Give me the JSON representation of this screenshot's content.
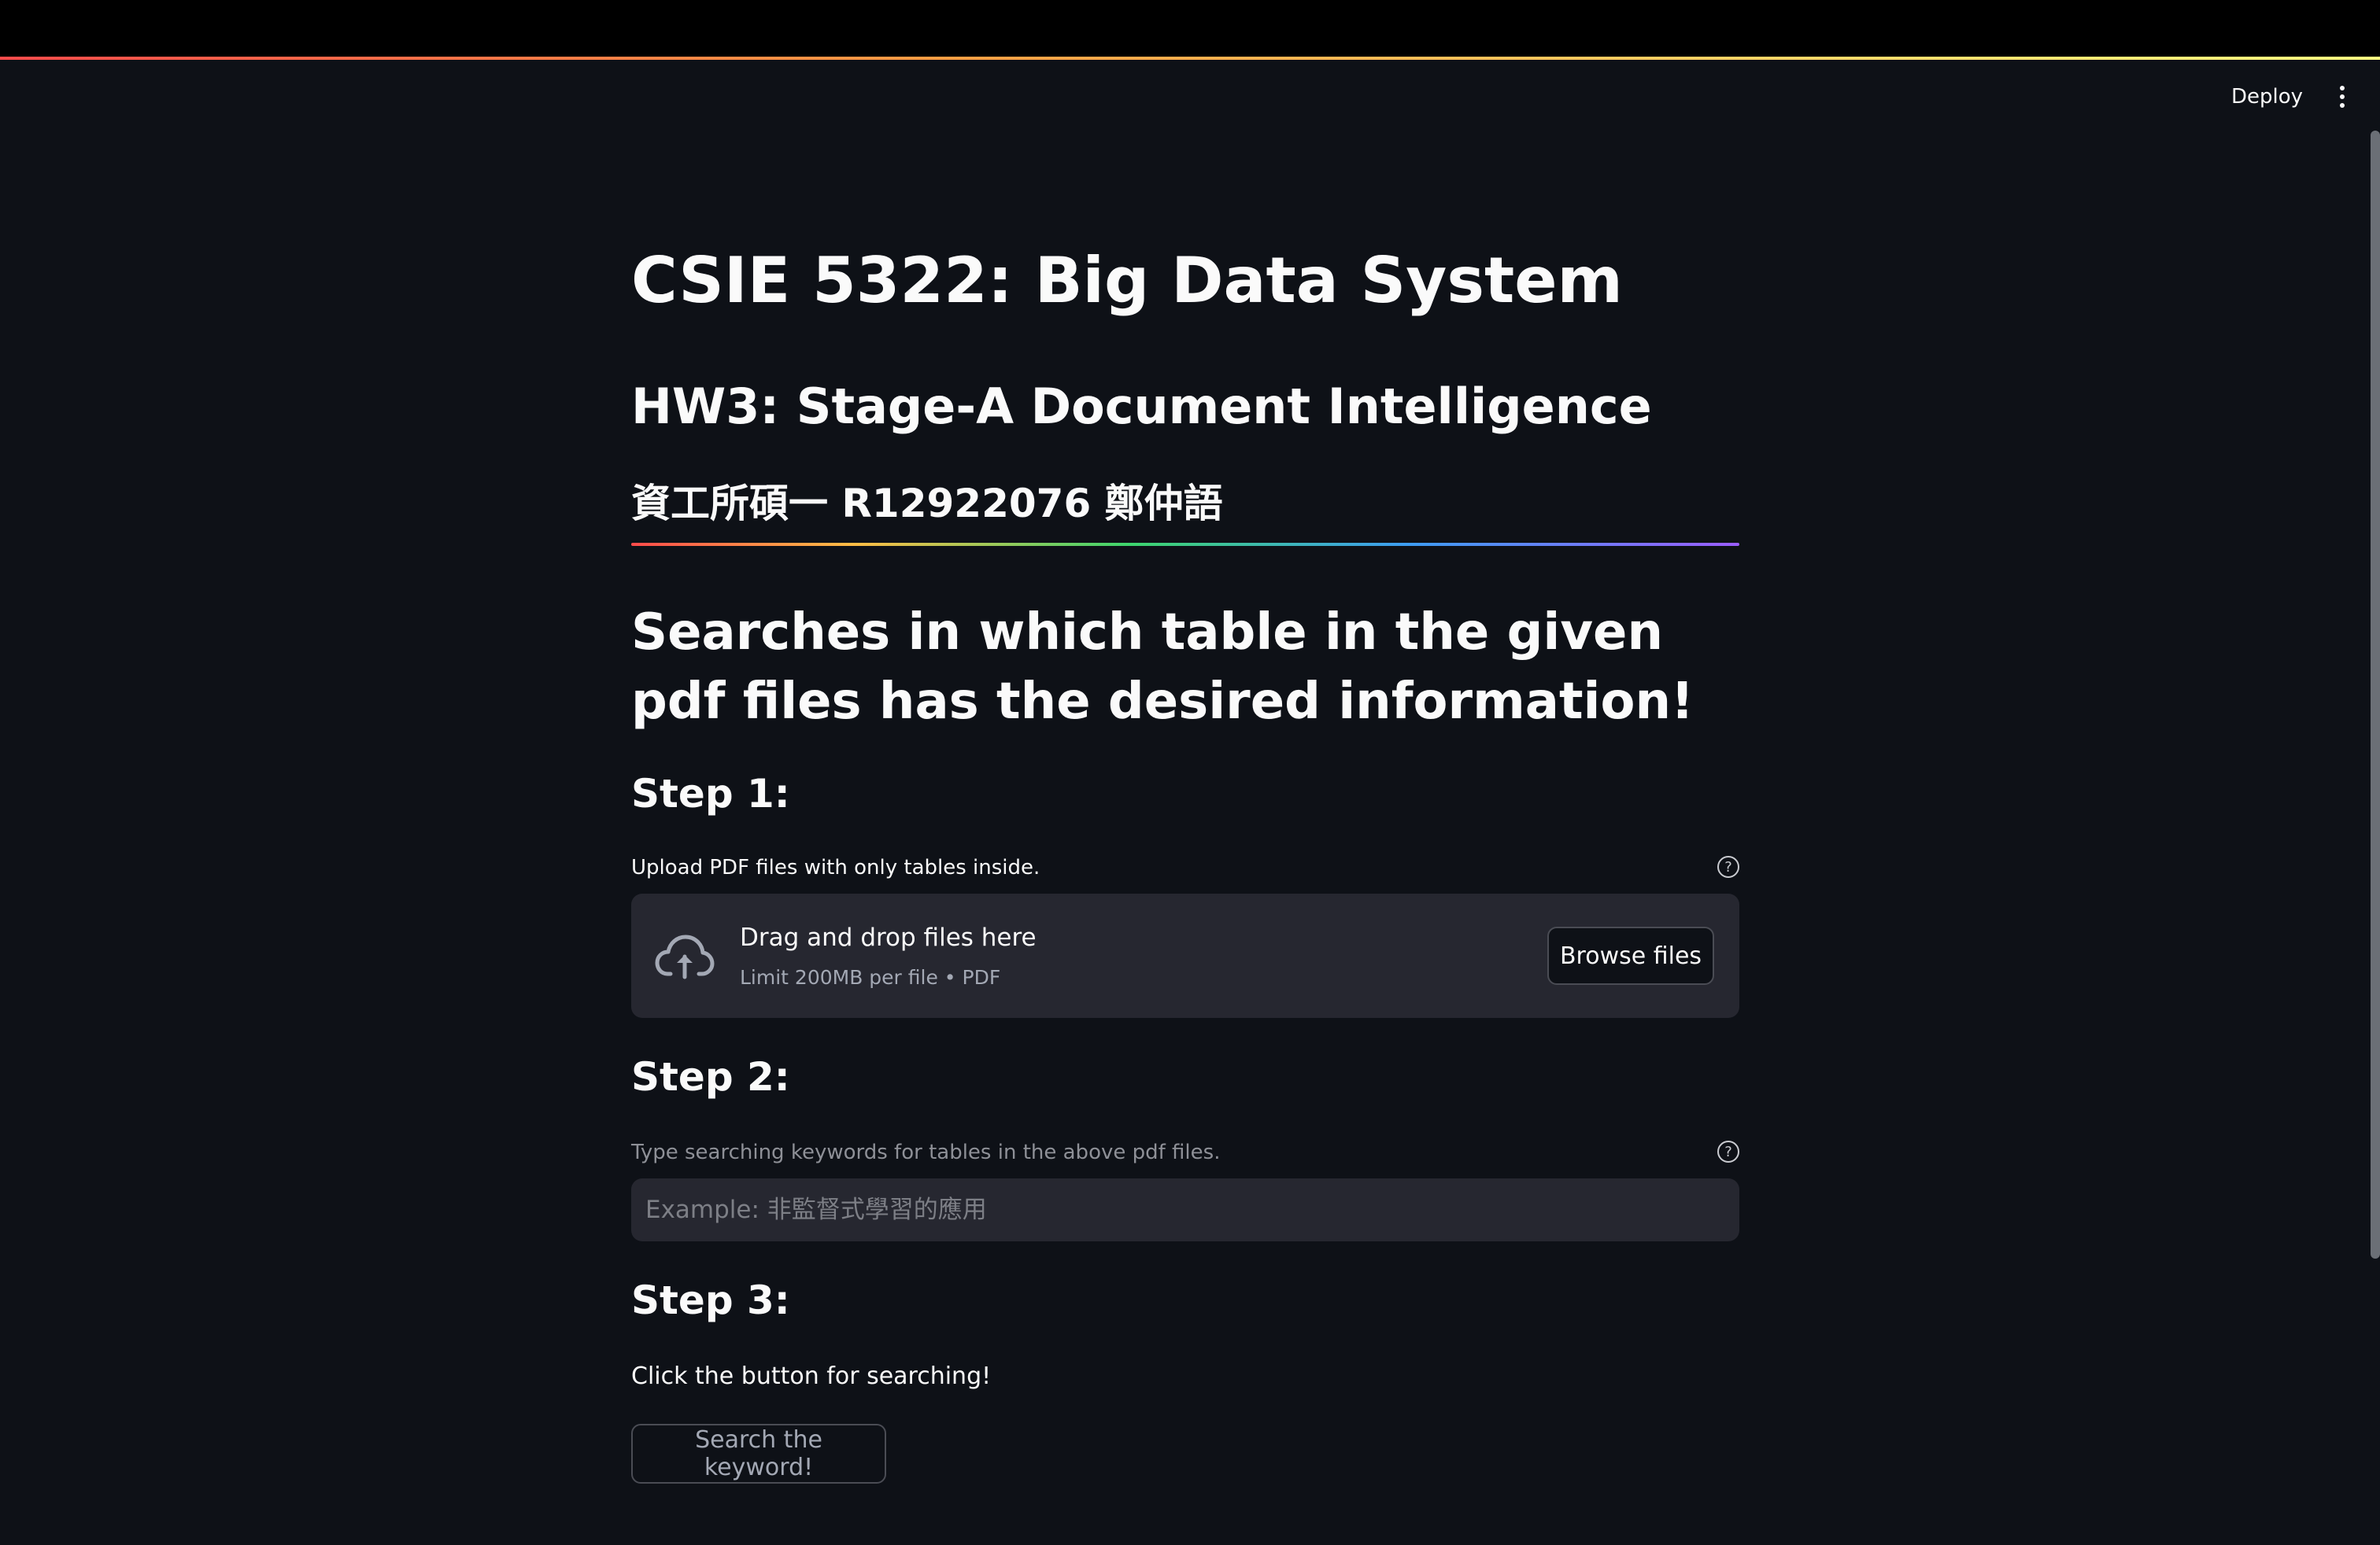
{
  "header": {
    "deploy_label": "Deploy",
    "menu_icon": "vertical-ellipsis-icon"
  },
  "page": {
    "title": "CSIE 5322: Big Data System",
    "subtitle": "HW3: Stage-A Document Intelligence",
    "author": "資工所碩一 R12922076 鄭仲語",
    "headline": "Searches in which table in the given pdf files has the desired information!"
  },
  "step1": {
    "heading": "Step 1:",
    "label": "Upload PDF files with only tables inside.",
    "help_icon": "question-circle-icon",
    "uploader": {
      "icon": "cloud-upload-icon",
      "drag_text": "Drag and drop files here",
      "limit_text": "Limit 200MB per file • PDF",
      "browse_label": "Browse files"
    }
  },
  "step2": {
    "heading": "Step 2:",
    "label": "Type searching keywords for tables in the above pdf files.",
    "help_icon": "question-circle-icon",
    "input_placeholder": "Example: 非監督式學習的應用",
    "input_value": ""
  },
  "step3": {
    "heading": "Step 3:",
    "label": "Click the button for searching!",
    "button_label": "Search the keyword!"
  },
  "colors": {
    "background": "#0e1117",
    "widget_bg": "#262730",
    "text": "#fafafa",
    "muted_text": "#8e9097"
  }
}
